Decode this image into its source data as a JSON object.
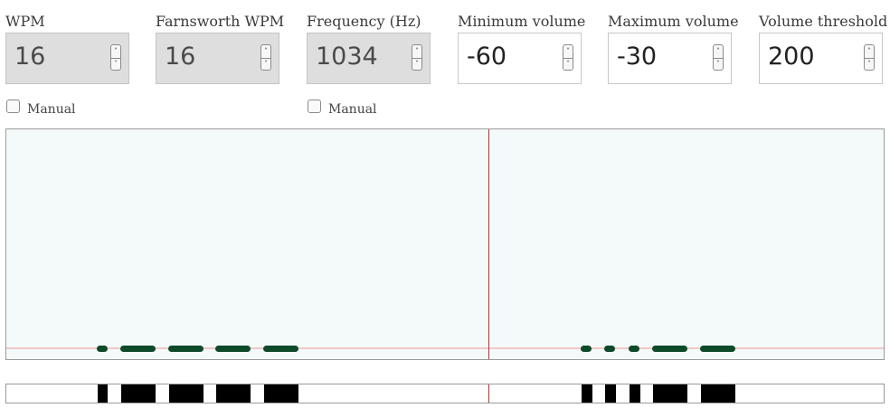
{
  "controls": [
    {
      "label": "WPM",
      "value": "16",
      "disabled": true
    },
    {
      "label": "Farnsworth WPM",
      "value": "16",
      "disabled": true
    },
    {
      "label": "Frequency (Hz)",
      "value": "1034",
      "disabled": true
    },
    {
      "label": "Minimum volume",
      "value": "-60",
      "disabled": false
    },
    {
      "label": "Maximum volume",
      "value": "-30",
      "disabled": false
    },
    {
      "label": "Volume threshold",
      "value": "200",
      "disabled": false
    }
  ],
  "manual_checkboxes": [
    {
      "label": "Manual",
      "checked": false
    },
    {
      "label": "Manual",
      "checked": false
    }
  ],
  "icons": {
    "spin_up": "chevron-up-icon",
    "spin_down": "chevron-down-icon"
  },
  "colors": {
    "scope_background": "#f4f9f9",
    "signal_mark": "#0d4a2a",
    "threshold_line": "#f0b8b8",
    "cursor_line": "#c0302a",
    "keyer_mark": "#000000"
  }
}
